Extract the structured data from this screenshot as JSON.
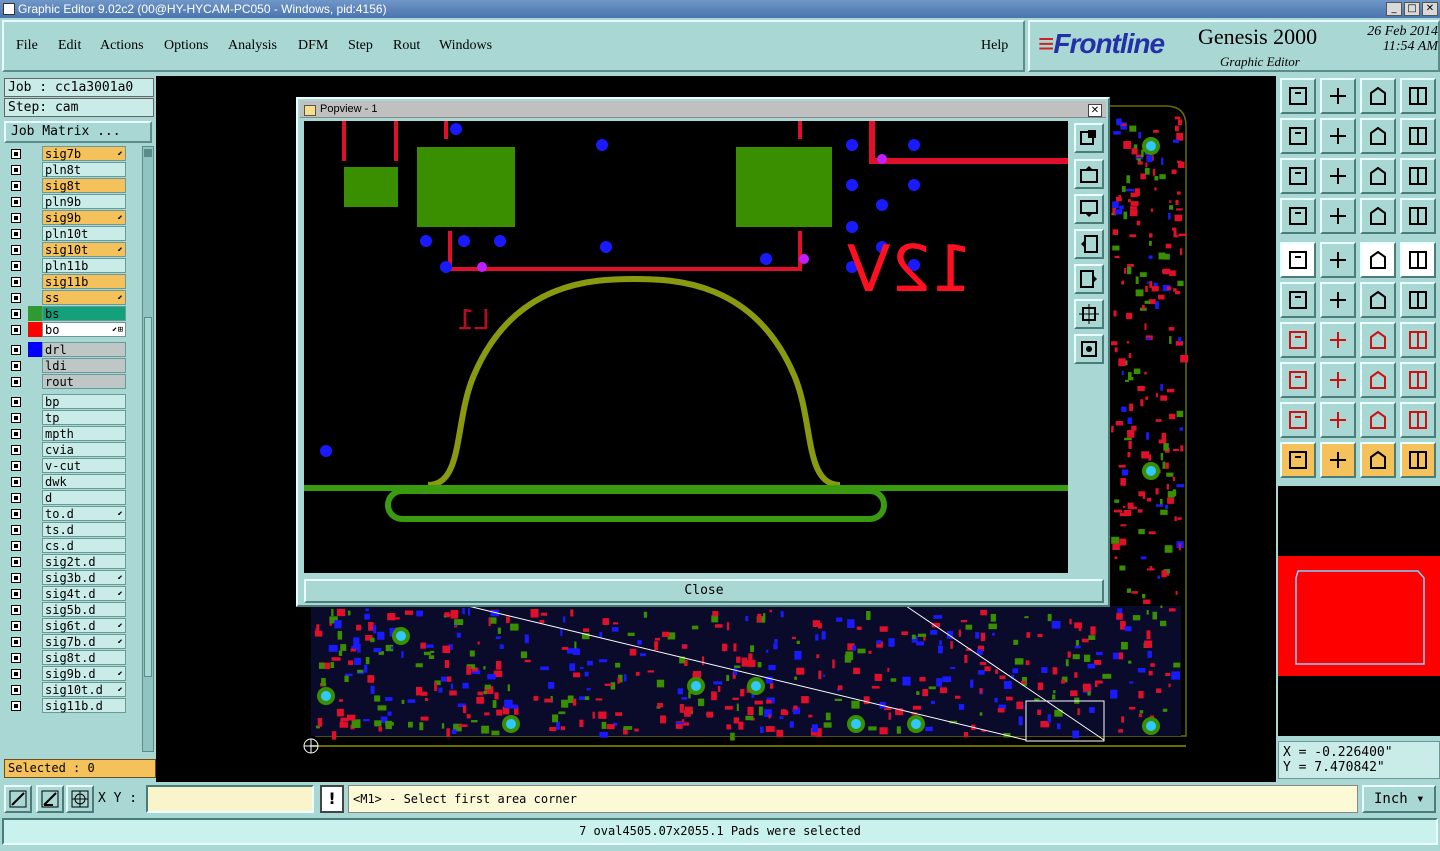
{
  "window": {
    "title": "Graphic Editor 9.02c2 (00@HY-HYCAM-PC050 - Windows, pid:4156)",
    "min": "_",
    "max": "□",
    "close": "✕"
  },
  "menu": [
    {
      "label": "File"
    },
    {
      "label": "Edit"
    },
    {
      "label": "Actions"
    },
    {
      "label": "Options"
    },
    {
      "label": "Analysis"
    },
    {
      "label": "DFM"
    },
    {
      "label": "Step"
    },
    {
      "label": "Rout"
    },
    {
      "label": "Windows"
    },
    {
      "label": "Help"
    }
  ],
  "brand": {
    "logo": "Frontline",
    "product": "Genesis 2000",
    "subtitle": "Graphic Editor",
    "date": "26 Feb 2014",
    "time": "11:54 AM"
  },
  "job": {
    "label": "Job : cc1a3001a0",
    "step": "Step: cam",
    "matrix_button": "Job Matrix ..."
  },
  "layers": [
    {
      "name": "sig7b",
      "color": "#f5c15a",
      "mark": "⬋"
    },
    {
      "name": "pln8t",
      "color": "#c9ece9",
      "mark": ""
    },
    {
      "name": "sig8t",
      "color": "#f5c15a",
      "mark": ""
    },
    {
      "name": "pln9b",
      "color": "#c9ece9",
      "mark": ""
    },
    {
      "name": "sig9b",
      "color": "#f5c15a",
      "mark": "⬋"
    },
    {
      "name": "pln10t",
      "color": "#c9ece9",
      "mark": ""
    },
    {
      "name": "sig10t",
      "color": "#f5c15a",
      "mark": "⬋"
    },
    {
      "name": "pln11b",
      "color": "#c9ece9",
      "mark": ""
    },
    {
      "name": "sig11b",
      "color": "#f5c15a",
      "mark": ""
    },
    {
      "name": "ss",
      "color": "#f5c15a",
      "mark": "⬋"
    },
    {
      "name": "bs",
      "color": "#14a07a",
      "mark": "",
      "swatch": "#2f9a2f"
    },
    {
      "name": "bo",
      "color": "#ffffff",
      "mark": "⬋⊞",
      "swatch": "#ff0000"
    },
    {
      "name": "drl",
      "color": "#bfc6c6",
      "mark": "",
      "swatch": "#0000ff"
    },
    {
      "name": "ldi",
      "color": "#bfc6c6",
      "mark": ""
    },
    {
      "name": "rout",
      "color": "#bfc6c6",
      "mark": ""
    },
    {
      "name": "bp",
      "color": "#c9ece9",
      "mark": ""
    },
    {
      "name": "tp",
      "color": "#c9ece9",
      "mark": ""
    },
    {
      "name": "mpth",
      "color": "#c9ece9",
      "mark": ""
    },
    {
      "name": "cvia",
      "color": "#c9ece9",
      "mark": ""
    },
    {
      "name": "v-cut",
      "color": "#c9ece9",
      "mark": ""
    },
    {
      "name": "dwk",
      "color": "#c9ece9",
      "mark": ""
    },
    {
      "name": "d",
      "color": "#c9ece9",
      "mark": ""
    },
    {
      "name": "to.d",
      "color": "#c9ece9",
      "mark": "⬋"
    },
    {
      "name": "ts.d",
      "color": "#c9ece9",
      "mark": ""
    },
    {
      "name": "cs.d",
      "color": "#c9ece9",
      "mark": ""
    },
    {
      "name": "sig2t.d",
      "color": "#c9ece9",
      "mark": ""
    },
    {
      "name": "sig3b.d",
      "color": "#c9ece9",
      "mark": "⬋"
    },
    {
      "name": "sig4t.d",
      "color": "#c9ece9",
      "mark": "⬋"
    },
    {
      "name": "sig5b.d",
      "color": "#c9ece9",
      "mark": ""
    },
    {
      "name": "sig6t.d",
      "color": "#c9ece9",
      "mark": "⬋"
    },
    {
      "name": "sig7b.d",
      "color": "#c9ece9",
      "mark": "⬋"
    },
    {
      "name": "sig8t.d",
      "color": "#c9ece9",
      "mark": ""
    },
    {
      "name": "sig9b.d",
      "color": "#c9ece9",
      "mark": "⬋"
    },
    {
      "name": "sig10t.d",
      "color": "#c9ece9",
      "mark": "⬋"
    },
    {
      "name": "sig11b.d",
      "color": "#c9ece9",
      "mark": ""
    }
  ],
  "selected": "Selected : 0",
  "popview": {
    "title": "Popview - 1",
    "close_button": "Close",
    "silkscreen_label": "12V",
    "ref_label": "L1"
  },
  "coords": {
    "x": "X = -0.226400\"",
    "y": "Y = 7.470842\""
  },
  "bottom": {
    "xy_label": "X Y :",
    "xy_value": "",
    "prompt": "<M1> - Select first area corner",
    "unit": "Inch"
  },
  "status": "7 oval4505.07x2055.1 Pads were selected",
  "colors": {
    "panel": "#a9d7d4",
    "signal_layer": "#f5c15a",
    "board": "#ff0000",
    "copper": "#3a8f00",
    "drill": "#1a1aff"
  }
}
